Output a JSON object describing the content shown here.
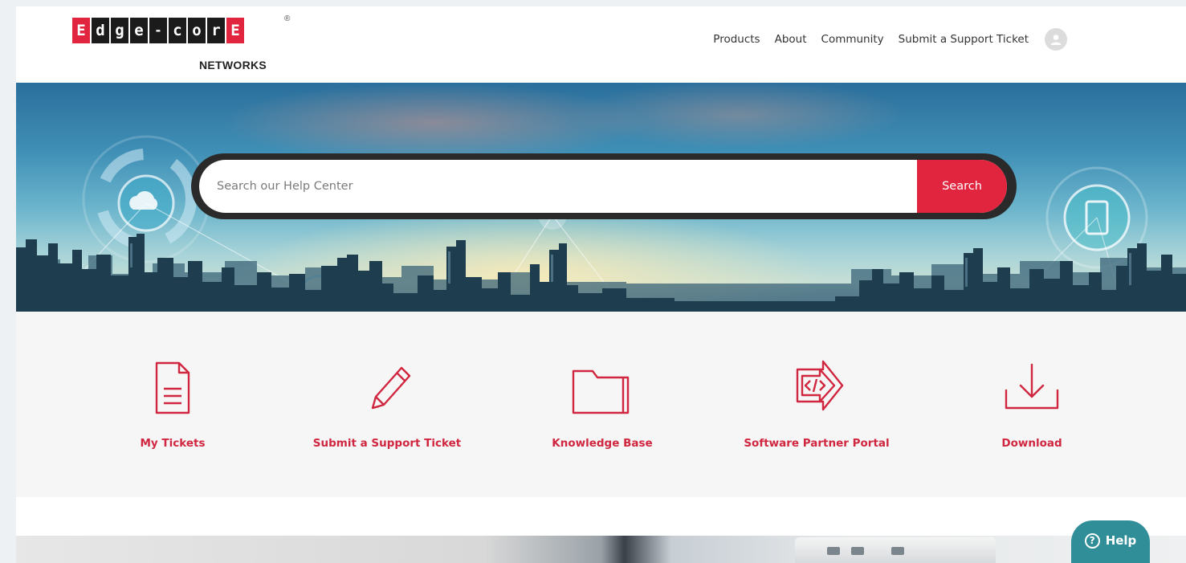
{
  "brand": {
    "tiles": [
      "E",
      "d",
      "g",
      "e",
      "-",
      "c",
      "o",
      "r",
      "E"
    ],
    "subtitle": "NETWORKS",
    "registered": "®"
  },
  "nav": {
    "items": [
      "Products",
      "About",
      "Community",
      "Submit a Support Ticket"
    ]
  },
  "search": {
    "placeholder": "Search our Help Center",
    "button_label": "Search"
  },
  "quick_links": [
    {
      "label": "My Tickets",
      "icon": "document-icon"
    },
    {
      "label": "Submit a Support Ticket",
      "icon": "pencil-icon"
    },
    {
      "label": "Knowledge Base",
      "icon": "folder-icon"
    },
    {
      "label": "Software Partner Portal",
      "icon": "code-arrow-icon"
    },
    {
      "label": "Download",
      "icon": "download-icon"
    }
  ],
  "help": {
    "label": "Help",
    "icon": "question-circle-icon"
  },
  "colors": {
    "brand_red": "#e1253f",
    "link_red": "#d0263f",
    "help_teal": "#2f8e97",
    "search_border": "#2a2a2a"
  }
}
